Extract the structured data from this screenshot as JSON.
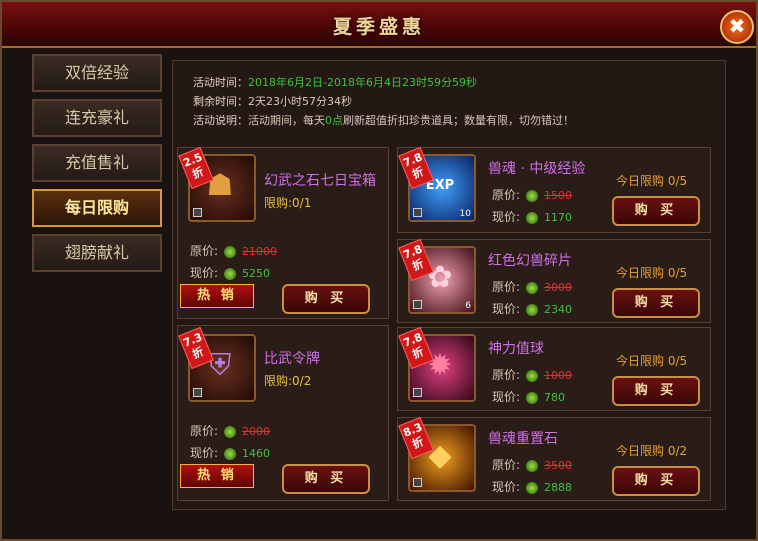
{
  "window": {
    "title": "夏季盛惠",
    "close_label": "✖"
  },
  "sidebar": {
    "tabs": [
      {
        "label": "双倍经验"
      },
      {
        "label": "连充豪礼"
      },
      {
        "label": "充值售礼"
      },
      {
        "label": "每日限购",
        "active": true
      },
      {
        "label": "翅膀献礼"
      }
    ]
  },
  "info": {
    "time_label": "活动时间：",
    "time_value": "2018年6月2日-2018年6月4日23时59分59秒",
    "remain_label": "剩余时间：",
    "remain_value": "2天23小时57分34秒",
    "desc_label": "活动说明：",
    "desc_pre": "活动期间，每天",
    "desc_hl": "0点",
    "desc_post": "刷新超值折扣珍贵道具；数量有限，切勿错过！"
  },
  "labels": {
    "orig": "原价:",
    "now": "现价:",
    "buy": "购 买",
    "hot": "热 销",
    "today_limit": "今日限购",
    "limit": "限购:"
  },
  "left_items": [
    {
      "discount": "2.5折",
      "name": "幻武之石七日宝箱",
      "limit": "0/1",
      "orig": "21000",
      "now": "5250",
      "icon": "chest-icon"
    },
    {
      "discount": "7.3折",
      "name": "比武令牌",
      "limit": "0/2",
      "orig": "2000",
      "now": "1460",
      "icon": "token-icon"
    }
  ],
  "right_items": [
    {
      "discount": "7.8折",
      "name": "兽魂 · 中级经验",
      "limit": "0/5",
      "orig": "1500",
      "now": "1170",
      "count": "10",
      "icon": "exp-orb-icon",
      "glyph_text": "EXP"
    },
    {
      "discount": "7.8折",
      "name": "红色幻兽碎片",
      "limit": "0/5",
      "orig": "3000",
      "now": "2340",
      "count": "6",
      "icon": "lotus-icon"
    },
    {
      "discount": "7.8折",
      "name": "神力值球",
      "limit": "0/5",
      "orig": "1000",
      "now": "780",
      "count": "",
      "icon": "power-orb-icon"
    },
    {
      "discount": "8.3折",
      "name": "兽魂重置石",
      "limit": "0/2",
      "orig": "3500",
      "now": "2888",
      "count": "",
      "icon": "reset-stone-icon"
    }
  ],
  "colors": {
    "accent": "#d49a3a",
    "discount": "#d01818",
    "price_new": "#40c040",
    "price_old": "#e03030",
    "name": "#d070e8"
  }
}
